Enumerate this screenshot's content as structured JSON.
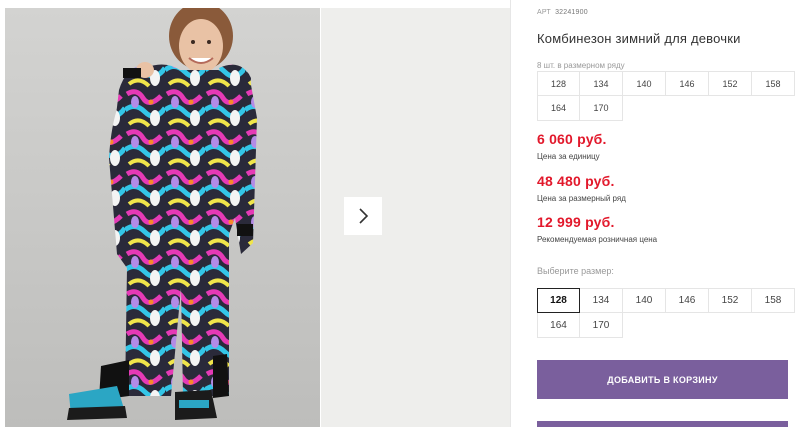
{
  "product": {
    "art_label": "АРТ",
    "art_number": "32241900",
    "title": "Комбинезон зимний для девочки",
    "row_note": "8 шт. в размерном ряду",
    "row_sizes": [
      "128",
      "134",
      "140",
      "146",
      "152",
      "158",
      "164",
      "170"
    ]
  },
  "prices": [
    {
      "value": "6 060 руб.",
      "caption": "Цена за единицу"
    },
    {
      "value": "48 480 руб.",
      "caption": "Цена за размерный ряд"
    },
    {
      "value": "12 999 руб.",
      "caption": "Рекомендуемая розничная цена"
    }
  ],
  "size_select": {
    "label": "Выберите размер:",
    "options": [
      "128",
      "134",
      "140",
      "146",
      "152",
      "158",
      "164",
      "170"
    ],
    "selected": "128"
  },
  "actions": {
    "add_to_cart": "ДОБАВИТЬ В КОРЗИНУ"
  },
  "gallery": {
    "next_icon": "chevron-right-icon"
  },
  "colors": {
    "accent": "#7a5f9d",
    "price": "#e2182b"
  }
}
